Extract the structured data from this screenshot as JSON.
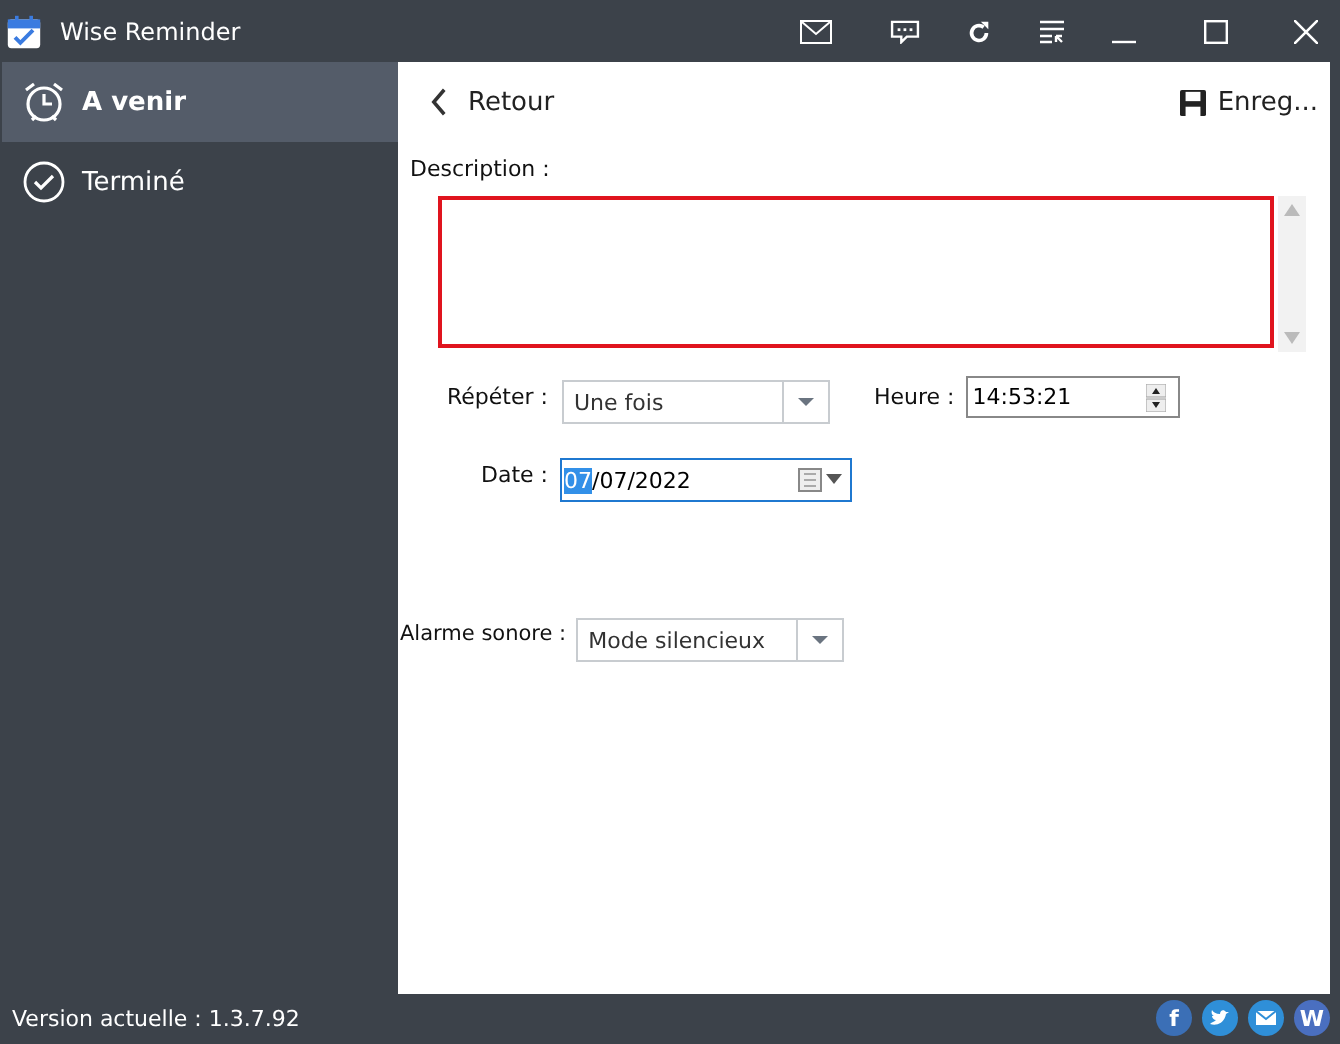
{
  "window": {
    "title": "Wise Reminder"
  },
  "sidebar": {
    "items": [
      {
        "label": "A venir",
        "kind": "alarm",
        "selected": true
      },
      {
        "label": "Terminé",
        "kind": "check",
        "selected": false
      }
    ]
  },
  "header": {
    "back": "Retour",
    "save": "Enreg..."
  },
  "form": {
    "description": {
      "label": "Description :",
      "invalid": true
    },
    "repeat": {
      "label": "Répéter :",
      "value": "Une fois"
    },
    "time": {
      "label": "Heure :",
      "value": "14:53:21"
    },
    "date": {
      "label": "Date :",
      "selected_part": "07",
      "rest": "/07/2022",
      "focused": true
    },
    "alarm": {
      "label": "Alarme sonore :",
      "value": "Mode silencieux"
    }
  },
  "status_bar": {
    "version": "Version actuelle : 1.3.7.92",
    "social": [
      {
        "kind": "letter",
        "text": "f",
        "color": "#3b6fb6"
      },
      {
        "kind": "bird",
        "color": "#2f8fd8"
      },
      {
        "kind": "mail",
        "color": "#2f8fd8"
      },
      {
        "kind": "letter",
        "text": "W",
        "color": "#4a6fc0"
      }
    ]
  }
}
